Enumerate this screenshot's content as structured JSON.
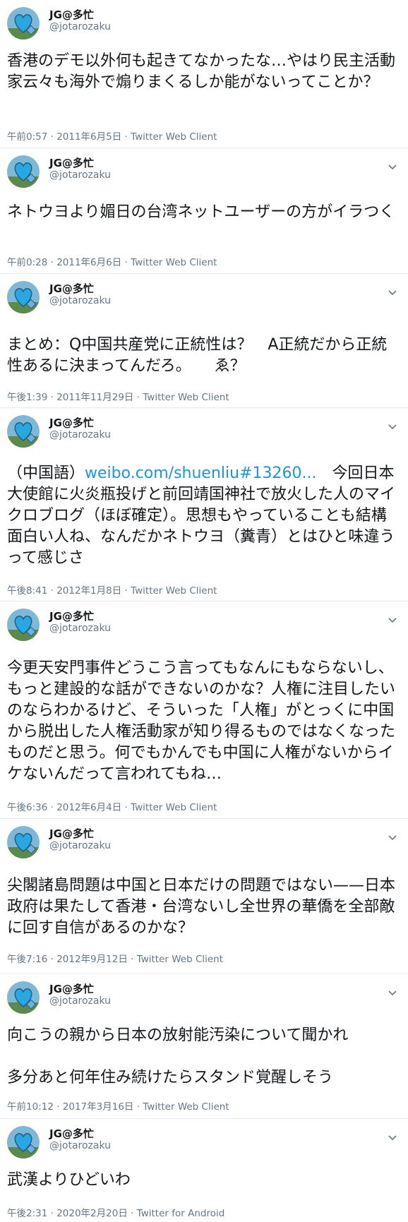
{
  "user": {
    "name": "JG@多忙",
    "handle": "@jotarozaku"
  },
  "colors": {
    "link": "#1b95e0",
    "secondary": "#657786",
    "divider": "#e6ecf0"
  },
  "icons": {
    "avatar": "blue-heart-avatar",
    "menu": "chevron-down-icon"
  },
  "tweets": [
    {
      "text": "香港のデモ以外何も起きてなかったな…やはり民主活動家云々も海外で煽りまくるしか能がないってことか？",
      "meta": "午前0:57 · 2011年6月5日 · Twitter Web Client",
      "has_chevron": false
    },
    {
      "text": "ネトウヨより媚日の台湾ネットユーザーの方がイラつく",
      "meta": "午前0:28 · 2011年6月6日 · Twitter Web Client",
      "has_chevron": true
    },
    {
      "text": "まとめ：Q中国共産党に正統性は？　A正統だから正統性あるに決まってんだろ。　　ゑ？",
      "meta": "午後1:39 · 2011年11月29日 · Twitter Web Client",
      "has_chevron": true
    },
    {
      "text_prefix": "（中国語）",
      "link": "weibo.com/shuenliu#13260...",
      "text": "　今回日本大使館に火炎瓶投げと前回靖国神社で放火した人のマイクロブログ（ほぼ確定）。思想もやっていることも結構面白い人ね、なんだかネトウヨ（糞青）とはひと味違うって感じさ",
      "meta": "午後8:41 · 2012年1月8日 · Twitter Web Client",
      "has_chevron": true
    },
    {
      "text": "今更天安門事件どうこう言ってもなんにもならないし、もっと建設的な話ができないのかな？人権に注目したいのならわかるけど、そういった「人権」がとっくに中国から脱出した人権活動家が知り得るものではなくなったものだと思う。何でもかんでも中国に人権がないからイケないんだって言われてもね…",
      "meta": "午後6:36 · 2012年6月4日 · Twitter Web Client",
      "has_chevron": true
    },
    {
      "text": "尖閣諸島問題は中国と日本だけの問題ではない——日本政府は果たして香港・台湾ないし全世界の華僑を全部敵に回す自信があるのかな？",
      "meta": "午後7:16 · 2012年9月12日 · Twitter Web Client",
      "has_chevron": true
    },
    {
      "text": "向こうの親から日本の放射能汚染について聞かれ\n\n多分あと何年住み続けたらスタンド覚醒しそう",
      "meta": "午前10:12 · 2017年3月16日 · Twitter Web Client",
      "has_chevron": true
    },
    {
      "text": "武漢よりひどいわ",
      "meta": "午後2:31 · 2020年2月20日 · Twitter for Android",
      "has_chevron": true
    }
  ]
}
